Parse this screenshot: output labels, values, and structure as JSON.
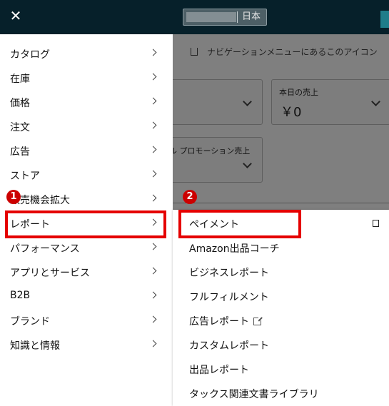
{
  "background": {
    "account_region": "日本",
    "hint_text": "ナビゲーションメニューにあるこのアイコン",
    "card_today_sales_label": "本日の売上",
    "card_today_sales_value": "￥0",
    "card_promo_label": "ル プロモーション売上"
  },
  "side_menu": {
    "close_label": "✕",
    "items": [
      {
        "label": "カタログ"
      },
      {
        "label": "在庫"
      },
      {
        "label": "価格"
      },
      {
        "label": "注文"
      },
      {
        "label": "広告"
      },
      {
        "label": "ストア"
      },
      {
        "label": "販売機会拡大"
      },
      {
        "label": "レポート"
      },
      {
        "label": "パフォーマンス"
      },
      {
        "label": "アプリとサービス"
      },
      {
        "label": "B2B"
      },
      {
        "label": "ブランド"
      },
      {
        "label": "知識と情報"
      }
    ]
  },
  "sub_menu": {
    "items": [
      {
        "label": "ペイメント"
      },
      {
        "label": "Amazon出品コーチ"
      },
      {
        "label": "ビジネスレポート"
      },
      {
        "label": "フルフィルメント"
      },
      {
        "label": "広告レポート"
      },
      {
        "label": "カスタムレポート"
      },
      {
        "label": "出品レポート"
      },
      {
        "label": "タックス関連文書ライブラリ"
      }
    ]
  },
  "annotations": {
    "badge1": "1",
    "badge2": "2"
  },
  "colors": {
    "header": "#06202a",
    "highlight": "#e50000",
    "badge": "#cc0000"
  }
}
